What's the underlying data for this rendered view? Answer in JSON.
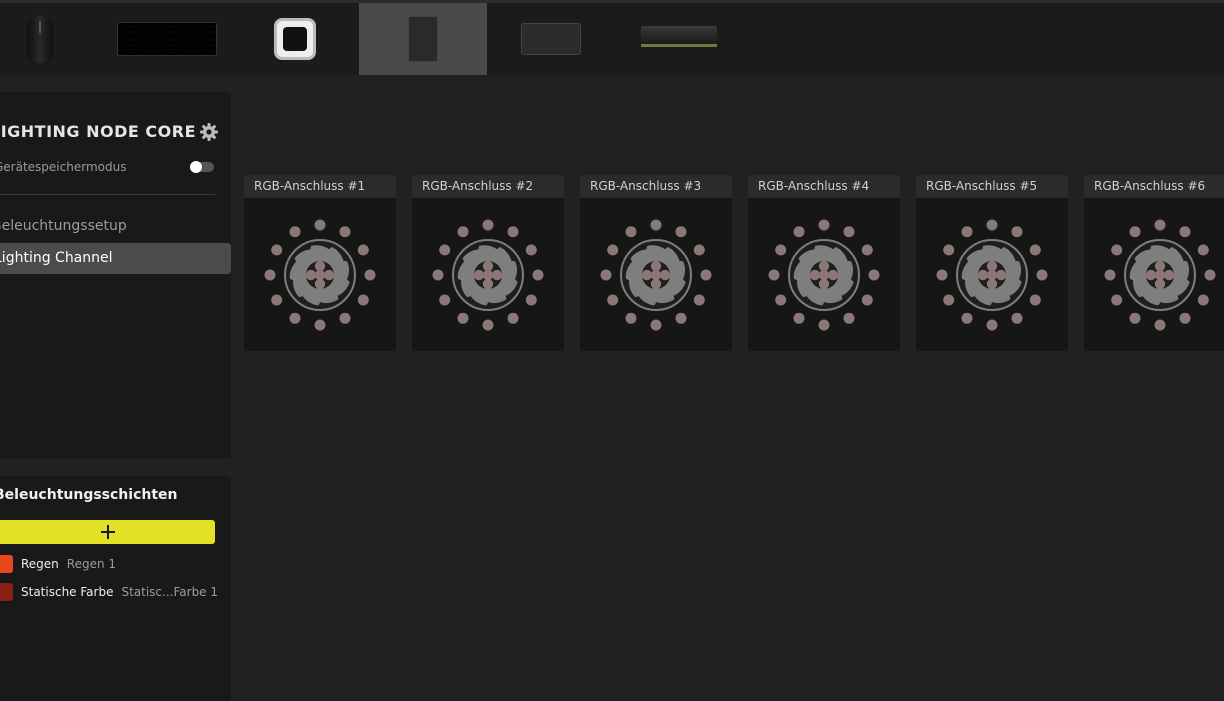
{
  "devices": [
    {
      "name": "mouse",
      "icon": "mouse-icon"
    },
    {
      "name": "keyboard",
      "icon": "keyboard-icon"
    },
    {
      "name": "aio-cooler",
      "icon": "aio-pump-icon"
    },
    {
      "name": "lighting-node-core",
      "icon": "lighting-node-icon",
      "selected": true
    },
    {
      "name": "fan-hub",
      "icon": "hub-icon"
    },
    {
      "name": "memory",
      "icon": "ram-icon"
    }
  ],
  "sidebar": {
    "device_title": "LIGHTING NODE CORE",
    "memory_mode_label": "Gerätespeichermodus",
    "memory_mode_on": false,
    "setup_label": "Beleuchtungssetup",
    "channel_label": "Lighting Channel"
  },
  "layers": {
    "title": "Beleuchtungsschichten",
    "add_icon": "plus-icon",
    "items": [
      {
        "name": "Regen",
        "subtitle": "Regen 1",
        "color": "#e8471e"
      },
      {
        "name": "Statische Farbe",
        "subtitle": "Statisc...Farbe 1",
        "color": "#8a2010"
      }
    ]
  },
  "ports": [
    {
      "label": "RGB-Anschluss #1"
    },
    {
      "label": "RGB-Anschluss #2"
    },
    {
      "label": "RGB-Anschluss #3"
    },
    {
      "label": "RGB-Anschluss #4"
    },
    {
      "label": "RGB-Anschluss #5"
    },
    {
      "label": "RGB-Anschluss #6"
    }
  ],
  "colors": {
    "accent": "#e3e227",
    "led": "#8a7776",
    "fan": "#7e7e7e"
  }
}
